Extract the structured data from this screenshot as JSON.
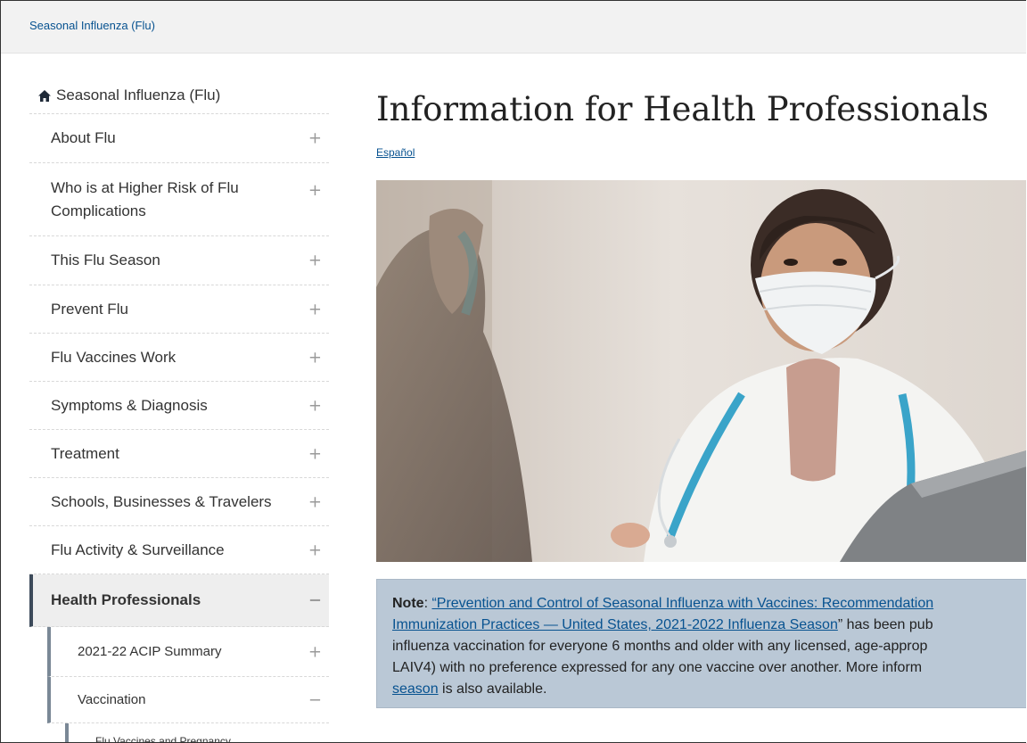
{
  "breadcrumb": {
    "label": "Seasonal Influenza (Flu)"
  },
  "sidebar": {
    "home_label": "Seasonal Influenza (Flu)",
    "items": [
      {
        "label": "About Flu",
        "toggle": "+"
      },
      {
        "label": "Who is at Higher Risk of Flu Complications",
        "toggle": "+"
      },
      {
        "label": "This Flu Season",
        "toggle": "+"
      },
      {
        "label": "Prevent Flu",
        "toggle": "+"
      },
      {
        "label": "Flu Vaccines Work",
        "toggle": "+"
      },
      {
        "label": "Symptoms & Diagnosis",
        "toggle": "+"
      },
      {
        "label": "Treatment",
        "toggle": "+"
      },
      {
        "label": "Schools, Businesses & Travelers",
        "toggle": "+"
      },
      {
        "label": "Flu Activity & Surveillance",
        "toggle": "+"
      },
      {
        "label": "Health Professionals",
        "toggle": "−"
      },
      {
        "label": "2021-22 ACIP Summary",
        "toggle": "+"
      },
      {
        "label": "Vaccination",
        "toggle": "−"
      },
      {
        "label": "Flu Vaccines and Pregnancy",
        "toggle": ""
      }
    ]
  },
  "main": {
    "title": "Information for Health Professionals",
    "language_link": "Español",
    "note": {
      "label": "Note",
      "colon": ": ",
      "link1_line1": "“Prevention and Control of Seasonal Influenza with Vaccines: Recommendation",
      "link1_line2": "Immunization Practices — United States, 2021-2022 Influenza Season",
      "after_link1": "” has been pub",
      "line3": "influenza vaccination for everyone 6 months and older with any licensed, age-approp",
      "line4": "LAIV4) with no preference expressed for any one vaccine over another. More inform",
      "link2": "season",
      "tail": " is also available."
    }
  },
  "colors": {
    "link": "#075290",
    "note_bg": "#bac8d6",
    "active_bar": "#3c4a5a"
  }
}
